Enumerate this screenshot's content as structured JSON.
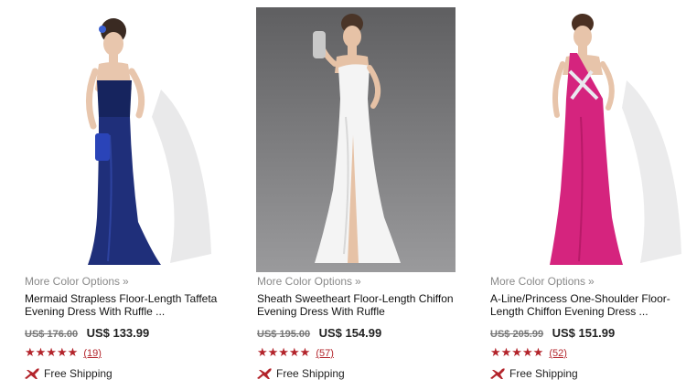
{
  "products": [
    {
      "more_colors": "More Color Options",
      "more_chevron": "»",
      "title": "Mermaid Strapless Floor-Length Taffeta Evening Dress With Ruffle ...",
      "old_price": "US$ 176.00",
      "new_price": "US$ 133.99",
      "stars": "★★★★★",
      "reviews": "(19)",
      "shipping": "Free Shipping",
      "dress_color": "#1f2f7a"
    },
    {
      "more_colors": "More Color Options",
      "more_chevron": "»",
      "title": "Sheath Sweetheart Floor-Length Chiffon Evening Dress With Ruffle",
      "old_price": "US$ 195.00",
      "new_price": "US$ 154.99",
      "stars": "★★★★★",
      "reviews": "(57)",
      "shipping": "Free Shipping",
      "dress_color": "#f4f4f4"
    },
    {
      "more_colors": "More Color Options",
      "more_chevron": "»",
      "title": "A-Line/Princess One-Shoulder Floor-Length Chiffon Evening Dress ...",
      "old_price": "US$ 205.99",
      "new_price": "US$ 151.99",
      "stars": "★★★★★",
      "reviews": "(52)",
      "shipping": "Free Shipping",
      "dress_color": "#d5247e"
    }
  ],
  "colors": {
    "accent_red": "#b3242b",
    "muted_text": "#8a8a8a"
  },
  "icons": {
    "shipping": "airplane-icon",
    "rating": "star-icon"
  }
}
